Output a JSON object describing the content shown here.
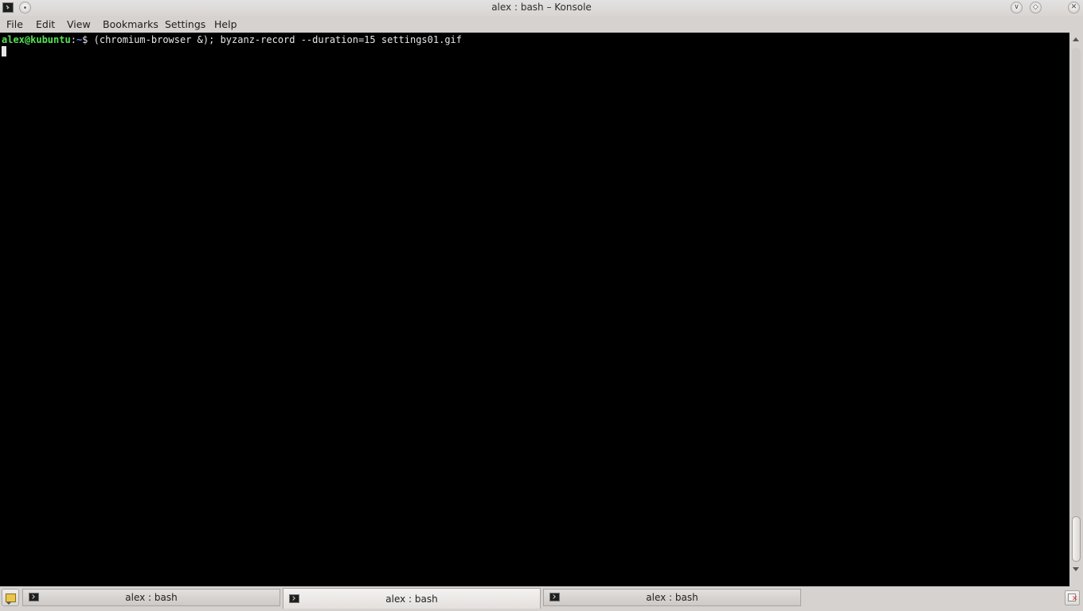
{
  "window": {
    "title": "alex : bash – Konsole",
    "app_icon": "konsole-terminal-icon",
    "buttons": [
      "pin-icon",
      "minimize-icon",
      "maximize-icon",
      "close-icon"
    ]
  },
  "menu": {
    "items": [
      {
        "label": "File"
      },
      {
        "label": "Edit"
      },
      {
        "label": "View"
      },
      {
        "label": "Bookmarks"
      },
      {
        "label": "Settings"
      },
      {
        "label": "Help"
      }
    ]
  },
  "terminal": {
    "prompt_user": "alex@kubuntu",
    "prompt_sep": ":",
    "prompt_path": "~",
    "prompt_symbol": "$ ",
    "command": "(chromium-browser &); byzanz-record --duration=15 settings01.gif",
    "colors": {
      "background": "#000000",
      "foreground": "#e6e6e6",
      "user": "#54e354",
      "path": "#6a8cf2"
    }
  },
  "tabs": [
    {
      "label": "alex : bash",
      "active": false
    },
    {
      "label": "alex : bash",
      "active": true
    },
    {
      "label": "alex : bash",
      "active": false
    }
  ],
  "tabbar": {
    "new_tab_icon": "new-tab-icon",
    "close_tab_icon": "close-tab-icon"
  }
}
